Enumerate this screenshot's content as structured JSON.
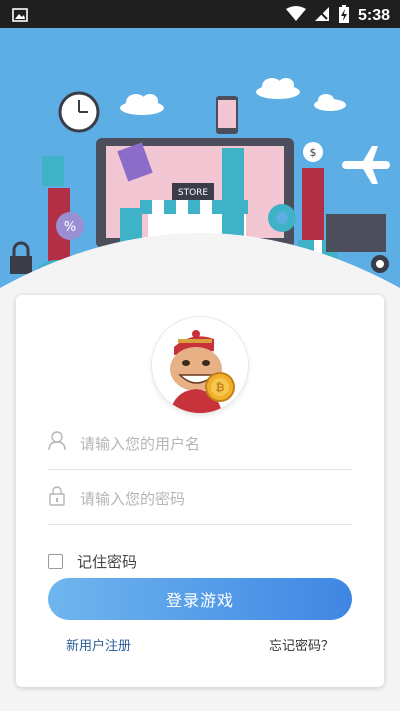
{
  "status_bar": {
    "time": "5:38",
    "icons": [
      "image-icon",
      "wifi-icon",
      "signal-icon",
      "battery-charging-icon"
    ]
  },
  "hero": {
    "store_sign": "STORE"
  },
  "login": {
    "username_placeholder": "请输入您的用户名",
    "password_placeholder": "请输入您的密码",
    "remember_label": "记住密码",
    "remember_checked": false,
    "login_button": "登录游戏",
    "register_link": "新用户注册",
    "forgot_link": "忘记密码？"
  },
  "colors": {
    "hero_bg": "#5eaee6",
    "button_gradient_start": "#6fb6ef",
    "button_gradient_end": "#3f86e3",
    "link": "#2b5f99"
  }
}
